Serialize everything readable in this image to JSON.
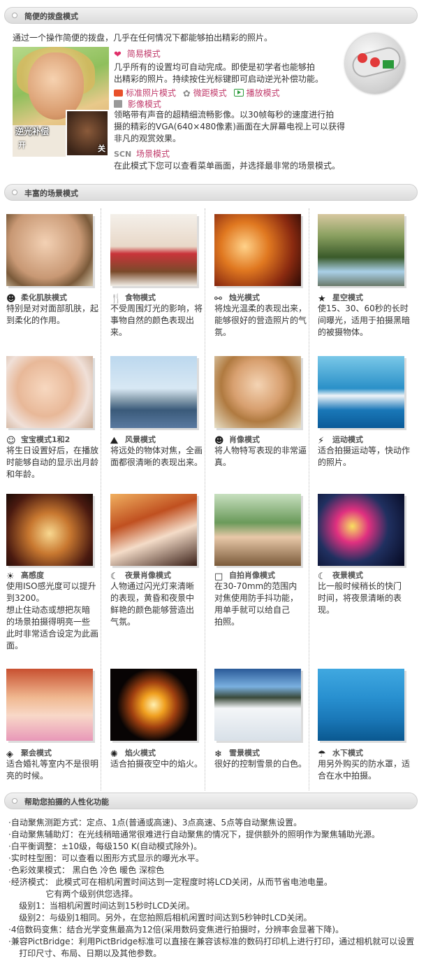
{
  "section1": {
    "header": "简便的拨盘模式",
    "intro": "通过一个操作简便的拨盘，几乎在任何情况下都能够拍出精彩的照片。",
    "hero_label": "逆光补偿",
    "hero_on": "开",
    "hero_off": "关",
    "easy_mode": "简易模式",
    "easy_desc1": "几乎所有的设置均可自动完成。即使是初学者也能够拍",
    "easy_desc2": "出精彩的照片。持续按住光标键即可启动逆光补偿功能。",
    "std_mode": "标准照片模式",
    "macro_mode": "微距模式",
    "play_mode": "播放模式",
    "movie_mode": "影像模式",
    "movie_desc1": "领略带有声音的超精细流畅影像。以30帧每秒的速度进行拍",
    "movie_desc2": "摄的精彩的VGA(640×480像素)画面在大屏幕电视上可以获得",
    "movie_desc3": "非凡的观赏效果。",
    "scn_prefix": "SCN",
    "scn_mode": "场景模式",
    "scn_desc": "在此模式下您可以查看菜单画面，并选择最非常的场景模式。"
  },
  "section2": {
    "header": "丰富的场景模式",
    "scenes": [
      {
        "name": "柔化肌肤模式",
        "desc": [
          "特别是对对面部肌肤，起",
          "到柔化的作用。"
        ]
      },
      {
        "name": "食物模式",
        "desc": [
          "不受周围灯光的影响，将",
          "事物自然的颜色表现出",
          "来。"
        ]
      },
      {
        "name": "烛光模式",
        "desc": [
          "将烛光温柔的表现出来，",
          "能够很好的营造照片的气",
          "氛。"
        ]
      },
      {
        "name": "星空模式",
        "desc": [
          "使15、30、60秒的长时",
          "间曝光，适用于拍摄黑暗",
          "的被摄物体。"
        ]
      },
      {
        "name": "宝宝模式1和2",
        "desc": [
          "将生日设置好后，在播放",
          "时能够自动的显示出月龄",
          "和年龄。"
        ]
      },
      {
        "name": "风景模式",
        "desc": [
          "将远处的物体对焦，全画",
          "面都很清晰的表现出来。"
        ]
      },
      {
        "name": "肖像模式",
        "desc": [
          "将人物特写表现的非常逼",
          "真。"
        ]
      },
      {
        "name": "运动模式",
        "desc": [
          "适合拍摄运动等，快动作",
          "的照片。"
        ]
      },
      {
        "name": "高感度",
        "desc": [
          "使用ISO感光度可以提升",
          "到3200。",
          "想止住动态或想把灰暗",
          "的场景拍摄得明亮一些",
          "此时非常适合设定为此画",
          "面。"
        ]
      },
      {
        "name": "夜景肖像模式",
        "desc": [
          "人物通过闪光灯来清晰",
          "的表现，黄昏和夜景中",
          "鲜艳的颜色能够营造出",
          "气氛。"
        ]
      },
      {
        "name": "自拍肖像模式",
        "desc": [
          "在30-70mm的范围内",
          "对焦使用防手抖功能，",
          "用单手就可以给自己",
          "拍照。"
        ]
      },
      {
        "name": "夜景模式",
        "desc": [
          "比一般时候稍长的快门",
          "时间，将夜景清晰的表",
          "现。"
        ]
      },
      {
        "name": "聚会模式",
        "desc": [
          "适合婚礼等室内不是很明",
          "亮的时候。"
        ]
      },
      {
        "name": "焰火模式",
        "desc": [
          "适合拍摄夜空中的焰火。"
        ]
      },
      {
        "name": "雪景模式",
        "desc": [
          "很好的控制雪景的白色。"
        ]
      },
      {
        "name": "水下模式",
        "desc": [
          "用另外购买的防水罩，适",
          "合在水中拍摄。"
        ]
      }
    ]
  },
  "section3": {
    "header": "帮助您拍摄的人性化功能",
    "lines": [
      "·自动聚焦测距方式：定点、1点(普通或高速)、3点高速、5点等自动聚焦设置。",
      "·自动聚焦辅助灯：在光线稍暗通常很难进行自动聚焦的情况下，提供额外的照明作为聚焦辅助光源。",
      "·白平衡调整：±10级，每级150 K(自动模式除外)。",
      "·实时柱型图：可以查看以图形方式显示的曝光水平。",
      "·色彩效果模式： 黑白色 冷色 暖色 深棕色",
      "·经济模式： 此模式可在相机闲置时间达到一定程度时将LCD关闭，从而节省电池电量。",
      "              它有两个级别供您选择。",
      "    级别1：当相机闲置时间达到15秒时LCD关闭。",
      "    级别2：与级别1相同。另外，在您拍照后相机闲置时间达到5秒钟时LCD关闭。",
      "·4倍数码变焦：结合光学变焦最高为12倍(采用数码变焦进行拍摄时，分辨率会显著下降)。",
      "·兼容PictBridge：利用PictBridge标准可以直接在兼容该标准的数码打印机上进行打印，通过相机就可以设置",
      "    打印尺寸、布局、日期以及其他参数。"
    ]
  }
}
